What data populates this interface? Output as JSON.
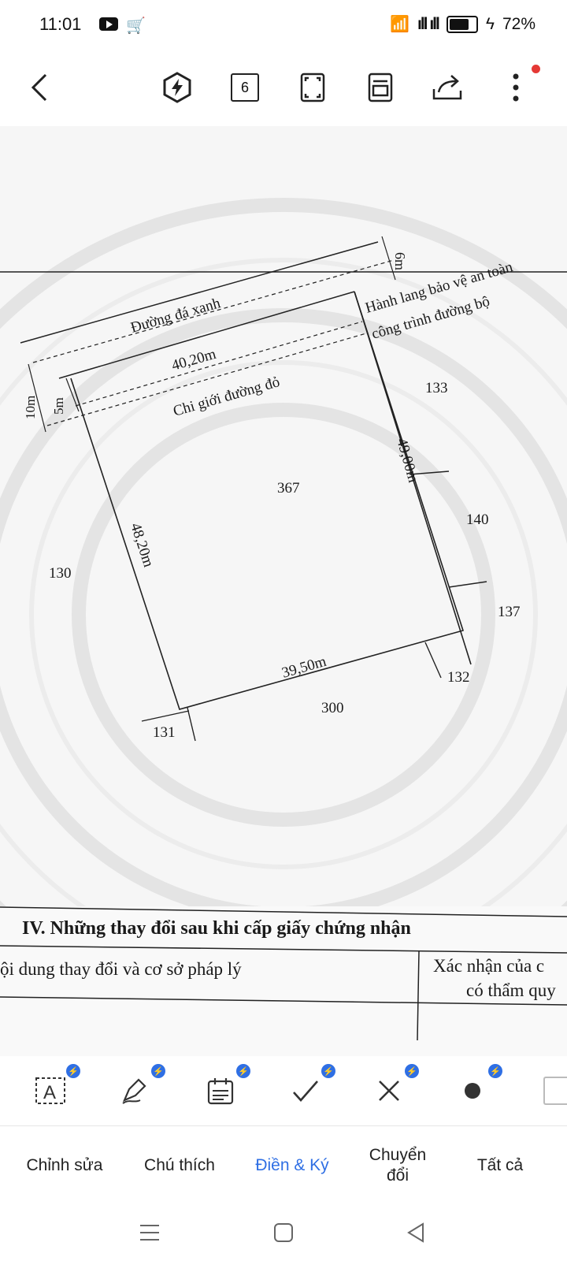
{
  "status": {
    "time": "11:01",
    "battery": "72%"
  },
  "appbar": {
    "page_count": "6"
  },
  "document": {
    "map": {
      "road_name": "Đường đá xanh",
      "road_width": "6m",
      "corridor_line1": "Hành lang bảo vệ an toàn",
      "corridor_line2": "công trình đường bộ",
      "top_edge": "40,20m",
      "red_line": "Chi giới đường đỏ",
      "offset_10": "10m",
      "offset_5": "5m",
      "right_edge": "49,00m",
      "left_edge": "48,20m",
      "bottom_edge": "39,50m",
      "parcel_main": "367",
      "parcel_133": "133",
      "parcel_140": "140",
      "parcel_137": "137",
      "parcel_130": "130",
      "parcel_132": "132",
      "parcel_300": "300",
      "parcel_131": "131"
    },
    "section": {
      "title": "IV. Những thay đổi sau khi cấp giấy chứng nhận",
      "col1": "ội dung thay đổi và cơ sở pháp lý",
      "col2_line1": "Xác nhận của c",
      "col2_line2": "có thẩm quy"
    }
  },
  "tools": [
    {
      "name": "text-tool",
      "badge": "⚡"
    },
    {
      "name": "sign-tool",
      "badge": "⚡"
    },
    {
      "name": "date-tool",
      "badge": "⚡"
    },
    {
      "name": "check-tool",
      "badge": "⚡"
    },
    {
      "name": "cross-tool",
      "badge": "⚡"
    },
    {
      "name": "dot-tool",
      "badge": "⚡"
    }
  ],
  "tabs": [
    {
      "label": "Chỉnh sửa"
    },
    {
      "label": "Chú thích"
    },
    {
      "label": "Điền & Ký"
    },
    {
      "label": "Chuyển\nđổi"
    },
    {
      "label": "Tất cả"
    }
  ],
  "colors": {
    "accent": "#2f6fe4",
    "notification_dot": "#e53935"
  }
}
